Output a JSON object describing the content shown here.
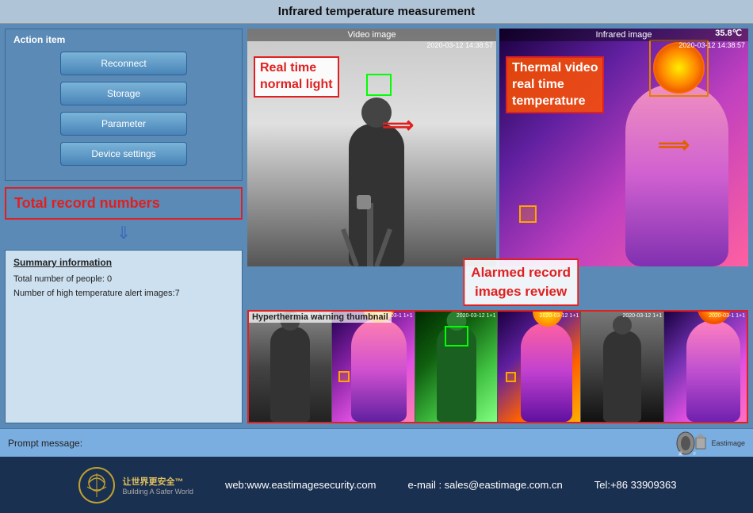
{
  "title": "Infrared temperature measurement",
  "left_panel": {
    "action_title": "Action item",
    "buttons": [
      "Reconnect",
      "Storage",
      "Parameter",
      "Device settings"
    ],
    "total_record_label": "Total record numbers",
    "summary_title": "Summary information",
    "summary_line1": "Total number of people:  0",
    "summary_line2": "Number of high temperature alert images:7"
  },
  "video_section": {
    "left_label": "Video image",
    "right_label": "Infrared image",
    "timestamp_left": "2020-03-12 14:38:57",
    "timestamp_right": "2020-03-12 14:38:57",
    "real_time_label": "Real time\nnormal light",
    "thermal_label": "Thermal video\nreal time\ntemperature",
    "temp_value": "35.8℃"
  },
  "alarmed_label": "Alarmed record\nimages review",
  "thumbnail_section": {
    "label": "Hyperthermia warning thumbnail",
    "timestamps": [
      "2020-03-12 1+1",
      "2020-03-1 1+1",
      "2020-03-12 1+1",
      "2020-03-12 1+1",
      "2020-03-12 1+1",
      "2020-03-1 1+1"
    ]
  },
  "prompt": {
    "label": "Prompt message:"
  },
  "footer": {
    "web": "web:www.eastimagesecurity.com",
    "email": "e-mail : sales@eastimage.com.cn",
    "tel": "Tel:+86 33909363",
    "logo_text": "让世界更安全™\nBuilding A Safer World"
  }
}
